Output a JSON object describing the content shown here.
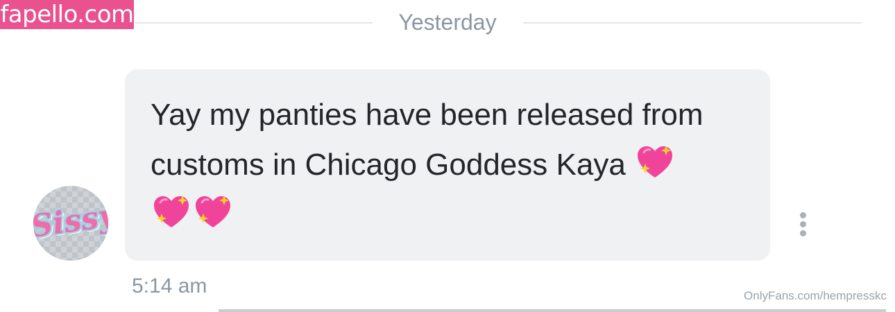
{
  "watermark": {
    "site": "fapello.com",
    "source": "OnlyFans.com/hempresskc"
  },
  "separator": {
    "date_label": "Yesterday"
  },
  "avatar": {
    "text": "Sissy"
  },
  "message": {
    "text_line1": "Yay my panties have been released from",
    "text_line2": "customs in Chicago Goddess Kaya",
    "emojis": [
      "sparkling-heart",
      "sparkling-heart",
      "sparkling-heart"
    ],
    "timestamp": "5:14 am"
  },
  "colors": {
    "badge": "#e9518f",
    "bubble": "#f0f1f3",
    "muted_text": "#8a96a3",
    "heart": "#f0449b"
  },
  "icons": {
    "more_options": "kebab-vertical-icon"
  }
}
